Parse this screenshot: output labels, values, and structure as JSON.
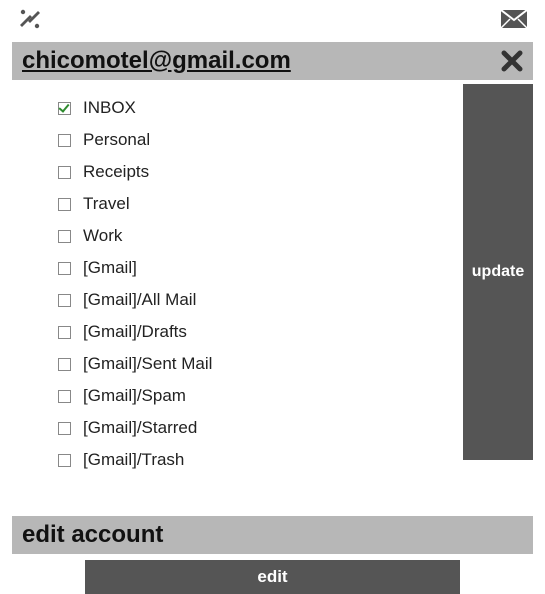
{
  "account_email": "chicomotel@gmail.com",
  "folders": [
    {
      "label": "INBOX",
      "checked": true
    },
    {
      "label": "Personal",
      "checked": false
    },
    {
      "label": "Receipts",
      "checked": false
    },
    {
      "label": "Travel",
      "checked": false
    },
    {
      "label": "Work",
      "checked": false
    },
    {
      "label": "[Gmail]",
      "checked": false
    },
    {
      "label": "[Gmail]/All Mail",
      "checked": false
    },
    {
      "label": "[Gmail]/Drafts",
      "checked": false
    },
    {
      "label": "[Gmail]/Sent Mail",
      "checked": false
    },
    {
      "label": "[Gmail]/Spam",
      "checked": false
    },
    {
      "label": "[Gmail]/Starred",
      "checked": false
    },
    {
      "label": "[Gmail]/Trash",
      "checked": false
    }
  ],
  "update_label": "update",
  "edit_section_title": "edit account",
  "edit_button_label": "edit"
}
